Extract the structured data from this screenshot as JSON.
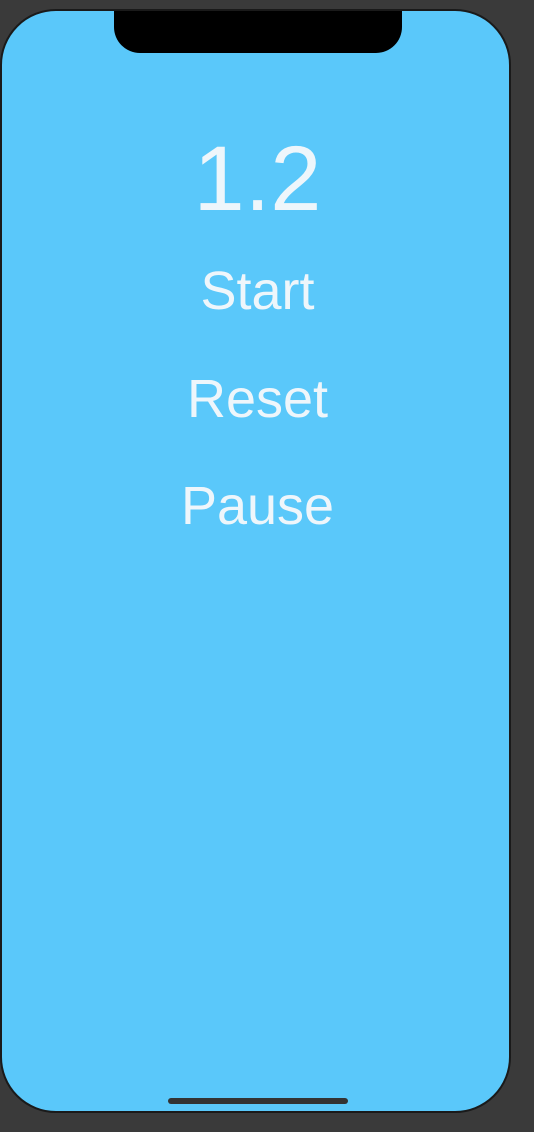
{
  "timer": {
    "value": "1.2"
  },
  "buttons": {
    "start_label": "Start",
    "reset_label": "Reset",
    "pause_label": "Pause"
  },
  "colors": {
    "background": "#5ac8fa",
    "text": "#eef6fb",
    "frame": "#3a3a3a"
  }
}
